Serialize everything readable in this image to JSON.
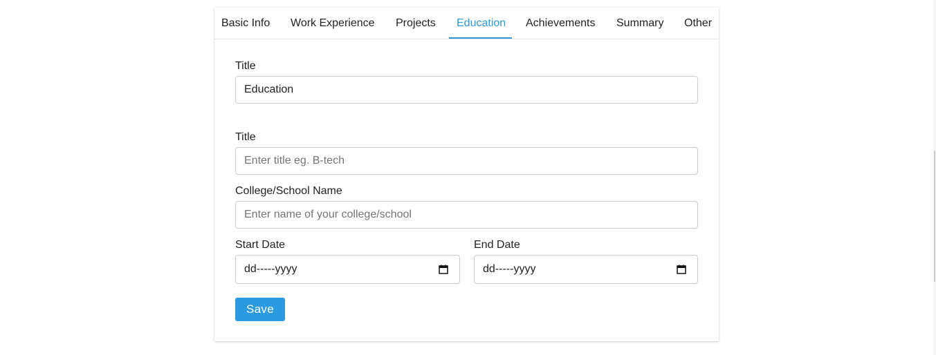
{
  "tabs": [
    {
      "label": "Basic Info",
      "active": false
    },
    {
      "label": "Work Experience",
      "active": false
    },
    {
      "label": "Projects",
      "active": false
    },
    {
      "label": "Education",
      "active": true
    },
    {
      "label": "Achievements",
      "active": false
    },
    {
      "label": "Summary",
      "active": false
    },
    {
      "label": "Other",
      "active": false
    }
  ],
  "section": {
    "title_label": "Title",
    "title_value": "Education"
  },
  "entry": {
    "title_label": "Title",
    "title_placeholder": "Enter title eg. B-tech",
    "college_label": "College/School Name",
    "college_placeholder": "Enter name of your college/school",
    "start_label": "Start Date",
    "start_value": "dd-----yyyy",
    "end_label": "End Date",
    "end_value": "dd-----yyyy"
  },
  "save_label": "Save",
  "colors": {
    "accent": "#2b9ae0",
    "border": "#cfcfcf",
    "text": "#222222",
    "placeholder": "#757575"
  },
  "icons": {
    "date_picker": "calendar-icon"
  }
}
